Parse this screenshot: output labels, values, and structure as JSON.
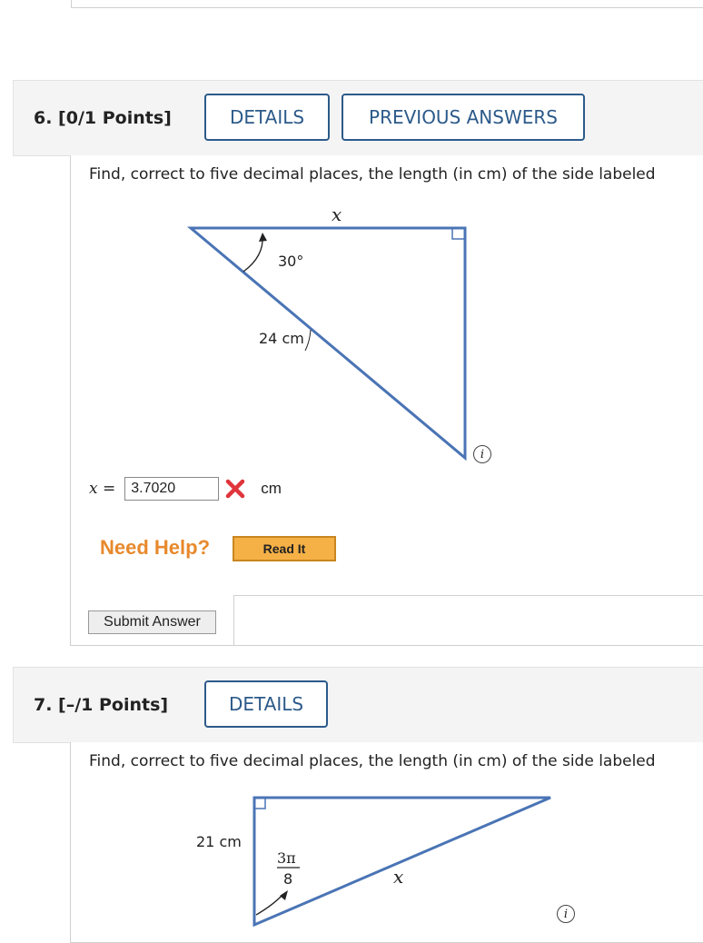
{
  "q6": {
    "number": "6.  [0/1 Points]",
    "details_label": "DETAILS",
    "prev_answers_label": "PREVIOUS ANSWERS",
    "question": "Find, correct to five decimal places, the length (in cm) of the side labeled",
    "diagram": {
      "x_label": "x",
      "angle_label": "30°",
      "hyp_label": "24 cm"
    },
    "answer": {
      "var_label": "x =",
      "value": "3.7020",
      "status_icon": "red-x-icon",
      "unit": "cm"
    },
    "need_help": "Need Help?",
    "read_it": "Read It",
    "submit": "Submit Answer"
  },
  "q7": {
    "number": "7.  [–/1 Points]",
    "details_label": "DETAILS",
    "question": "Find, correct to five decimal places, the length (in cm) of the side labeled",
    "diagram": {
      "side_label": "21 cm",
      "angle_num": "3π",
      "angle_den": "8",
      "x_label": "x"
    }
  },
  "colors": {
    "accent": "#2c5a8a",
    "triangle": "#4a74b5",
    "help": "#e8892c",
    "error": "#e0343b"
  }
}
